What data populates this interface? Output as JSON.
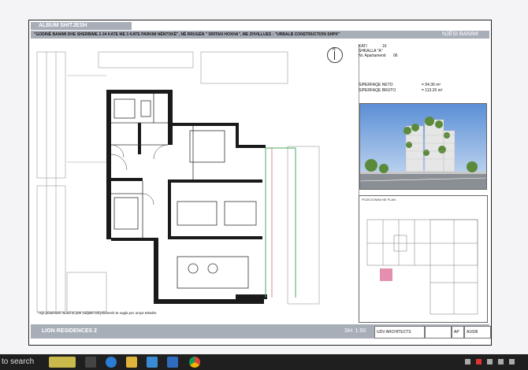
{
  "document": {
    "album_title": "ALBUM SHITJESH",
    "description": "\"GODINË BANIMI DHE SHERBIME 2-34 KATE  ME 3 KATE PARKIM NËNTOKË\", NË RRUGËN \" DRITAN HOXHA\", ME  ZHVILLUES : \"URBALB CONSTRUCTION SHPK\"",
    "unit_label": "NJËSI BANIMI",
    "info": {
      "kati_label": "KATI",
      "kati_value": "16",
      "shkalla": "SHKALLA \"A\"",
      "apartment_label": "Nr. Apartamenti",
      "apartment_value": "06",
      "neto_label": "SIPERFAQE NETO",
      "neto_value": "= 94.36 m²",
      "bruto_label": "SIPERFAQE BRUTO",
      "bruto_value": "= 113.26 m²"
    },
    "compass_label": "N",
    "positioning_label": "POZICIONIMI NE PLAN",
    "plan_note": "* Kjo planimetri mund te jete subjekt ndryshimesh te vogla per arsye teknike.",
    "footer": {
      "project": "LION  RESIDENCES 2",
      "scale": "SH: 1:50",
      "architects": "UDV ARCHITECTS",
      "sheet_prefix": "AP",
      "sheet_code": "A1606"
    }
  },
  "taskbar": {
    "search_text": "to search",
    "icons": [
      "widget-icon",
      "task-view-icon",
      "edge-icon",
      "file-explorer-icon",
      "store-icon",
      "mail-icon",
      "chrome-icon"
    ]
  },
  "colors": {
    "band": "#a8aeb8",
    "taskbar": "#1f1f1f",
    "wall": "#1a1a1a"
  }
}
